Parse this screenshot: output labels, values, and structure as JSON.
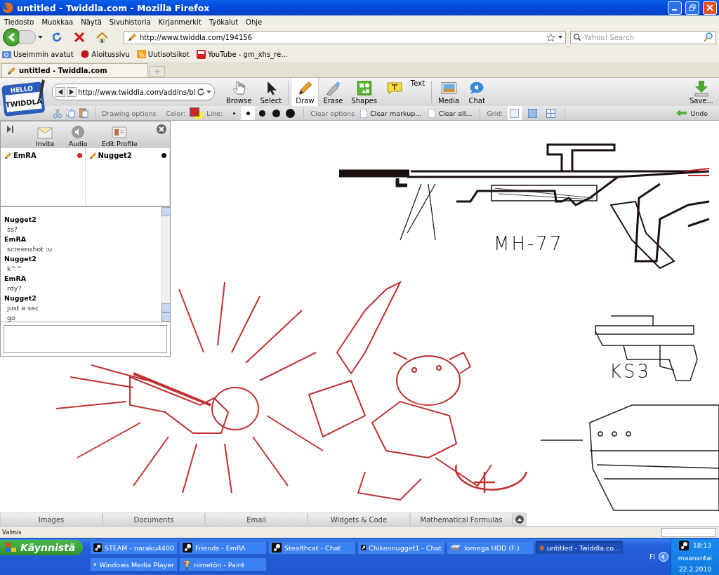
{
  "window": {
    "title": "untitled - Twiddla.com - Mozilla Firefox"
  },
  "menu": [
    "Tiedosto",
    "Muokkaa",
    "Näytä",
    "Sivuhistoria",
    "Kirjanmerkit",
    "Työkalut",
    "Ohje"
  ],
  "navigation": {
    "url": "http://www.twiddla.com/194156",
    "search_placeholder": "Yahoo! Search"
  },
  "bookmarks": [
    "Useimmin avatut",
    "Aloitussivu",
    "Uutisotsikot",
    "YouTube - gm_xhs_re..."
  ],
  "tabs": [
    {
      "label": "untitled - Twiddla.com",
      "selected": true
    }
  ],
  "twiddla": {
    "logo_top": "HELLO",
    "logo_main": "TWIDDLA",
    "url": "http://www.twiddla.com/addins/bl",
    "tools": [
      {
        "label": "Browse",
        "kind": "hand",
        "selected": false
      },
      {
        "label": "Select",
        "kind": "arrow",
        "selected": false
      },
      {
        "label": "Draw",
        "kind": "pencil",
        "selected": true
      },
      {
        "label": "Erase",
        "kind": "eraser",
        "selected": false
      },
      {
        "label": "Shapes",
        "kind": "shapes",
        "selected": false
      },
      {
        "label": "Text",
        "kind": "text",
        "selected": false
      },
      {
        "label": "Media",
        "kind": "media",
        "selected": false
      },
      {
        "label": "Chat",
        "kind": "chat",
        "selected": false
      }
    ],
    "save": "Save...",
    "drawing_options": "Drawing options",
    "color_label": "Color:",
    "color": "#c62a2a",
    "line_label": "Line:",
    "line_sizes": [
      {
        "selected": false
      },
      {
        "selected": true
      },
      {
        "selected": false
      },
      {
        "selected": false
      },
      {
        "selected": false
      }
    ],
    "clear_options": "Clear options",
    "clear_markup": "Clear markup...",
    "clear_all": "Clear all...",
    "grid_label": "Grid:",
    "grids": [
      {
        "selected": true
      },
      {
        "selected": false
      },
      {
        "selected": false
      }
    ],
    "undo": "Undo"
  },
  "chat_panel": {
    "buttons": [
      "Invite",
      "Audio",
      "Edit Profile"
    ],
    "users": [
      {
        "name": "EmRA",
        "color": "#d42020"
      },
      {
        "name": "Nugget2",
        "color": "#111111"
      }
    ],
    "messages": [
      {
        "author": "Nugget2",
        "lines": [
          "ss?"
        ]
      },
      {
        "author": "EmRA",
        "lines": [
          "screenshot :u"
        ]
      },
      {
        "author": "Nugget2",
        "lines": [
          "k^^"
        ]
      },
      {
        "author": "EmRA",
        "lines": [
          "rdy?"
        ]
      },
      {
        "author": "Nugget2",
        "lines": [
          "just a sec",
          "go"
        ]
      }
    ]
  },
  "canvas": {
    "labels": [
      "MH-77",
      "KS3"
    ]
  },
  "bottom_tabs": [
    "Images",
    "Documents",
    "Email",
    "Widgets & Code",
    "Mathematical Formulas"
  ],
  "status_bar": {
    "text": "Valmis"
  },
  "taskbar": {
    "start": "Käynnistä",
    "tasks": [
      {
        "label": "STEAM - naraku4400",
        "kind": "steam",
        "selected": false
      },
      {
        "label": "Friends - EmRA",
        "kind": "steam",
        "selected": false
      },
      {
        "label": "Stealthcat - Chat",
        "kind": "steam",
        "selected": false
      },
      {
        "label": "Chikennugget1 - Chat",
        "kind": "steam",
        "selected": false
      },
      {
        "label": "Iomega HDD (F:)",
        "kind": "drive",
        "selected": false
      },
      {
        "label": "untitled - Twiddla.co...",
        "kind": "firefox",
        "selected": true
      },
      {
        "label": "Windows Media Player",
        "kind": "media",
        "selected": false
      },
      {
        "label": "nimetön - Paint",
        "kind": "paint",
        "selected": false
      }
    ],
    "language": "FI",
    "time": "18:13",
    "day": "maanantai",
    "date": "22.2.2010"
  }
}
